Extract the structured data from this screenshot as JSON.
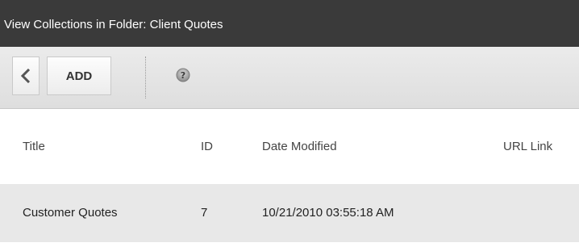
{
  "window": {
    "title": "View Collections in Folder: Client Quotes"
  },
  "toolbar": {
    "back_icon": "chevron-left-icon",
    "add_label": "ADD",
    "help_icon": "help-icon"
  },
  "table": {
    "columns": [
      "Title",
      "ID",
      "Date Modified",
      "URL Link"
    ],
    "rows": [
      {
        "title": "Customer Quotes",
        "id": "7",
        "date_modified": "10/21/2010 03:55:18 AM",
        "url_link": ""
      }
    ]
  },
  "colors": {
    "titlebar_bg": "#3a3a3a",
    "toolbar_bg": "#e4e4e4",
    "row_bg": "#e8e8e8"
  }
}
